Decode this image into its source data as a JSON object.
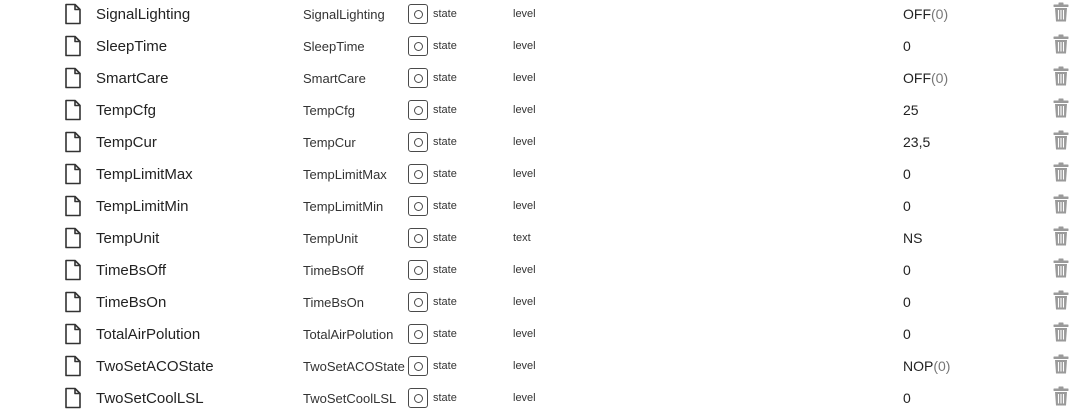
{
  "rows": [
    {
      "name": "SignalLighting",
      "id": "SignalLighting",
      "type": "state",
      "role": "level",
      "value": "OFF",
      "value_extra": "(0)"
    },
    {
      "name": "SleepTime",
      "id": "SleepTime",
      "type": "state",
      "role": "level",
      "value": "0",
      "value_extra": ""
    },
    {
      "name": "SmartCare",
      "id": "SmartCare",
      "type": "state",
      "role": "level",
      "value": "OFF",
      "value_extra": "(0)"
    },
    {
      "name": "TempCfg",
      "id": "TempCfg",
      "type": "state",
      "role": "level",
      "value": "25",
      "value_extra": ""
    },
    {
      "name": "TempCur",
      "id": "TempCur",
      "type": "state",
      "role": "level",
      "value": "23,5",
      "value_extra": ""
    },
    {
      "name": "TempLimitMax",
      "id": "TempLimitMax",
      "type": "state",
      "role": "level",
      "value": "0",
      "value_extra": ""
    },
    {
      "name": "TempLimitMin",
      "id": "TempLimitMin",
      "type": "state",
      "role": "level",
      "value": "0",
      "value_extra": ""
    },
    {
      "name": "TempUnit",
      "id": "TempUnit",
      "type": "state",
      "role": "text",
      "value": "NS",
      "value_extra": ""
    },
    {
      "name": "TimeBsOff",
      "id": "TimeBsOff",
      "type": "state",
      "role": "level",
      "value": "0",
      "value_extra": ""
    },
    {
      "name": "TimeBsOn",
      "id": "TimeBsOn",
      "type": "state",
      "role": "level",
      "value": "0",
      "value_extra": ""
    },
    {
      "name": "TotalAirPolution",
      "id": "TotalAirPolution",
      "type": "state",
      "role": "level",
      "value": "0",
      "value_extra": ""
    },
    {
      "name": "TwoSetACOState",
      "id": "TwoSetACOState",
      "type": "state",
      "role": "level",
      "value": "NOP",
      "value_extra": "(0)"
    },
    {
      "name": "TwoSetCoolLSL",
      "id": "TwoSetCoolLSL",
      "type": "state",
      "role": "level",
      "value": "0",
      "value_extra": ""
    }
  ],
  "icons": {
    "row_icon": "file-icon",
    "type_icon": "state-icon",
    "action_icon": "trash-icon"
  },
  "colors": {
    "trash": "#9a9a9a",
    "icon_stroke": "#333333",
    "muted_value": "#777777"
  }
}
